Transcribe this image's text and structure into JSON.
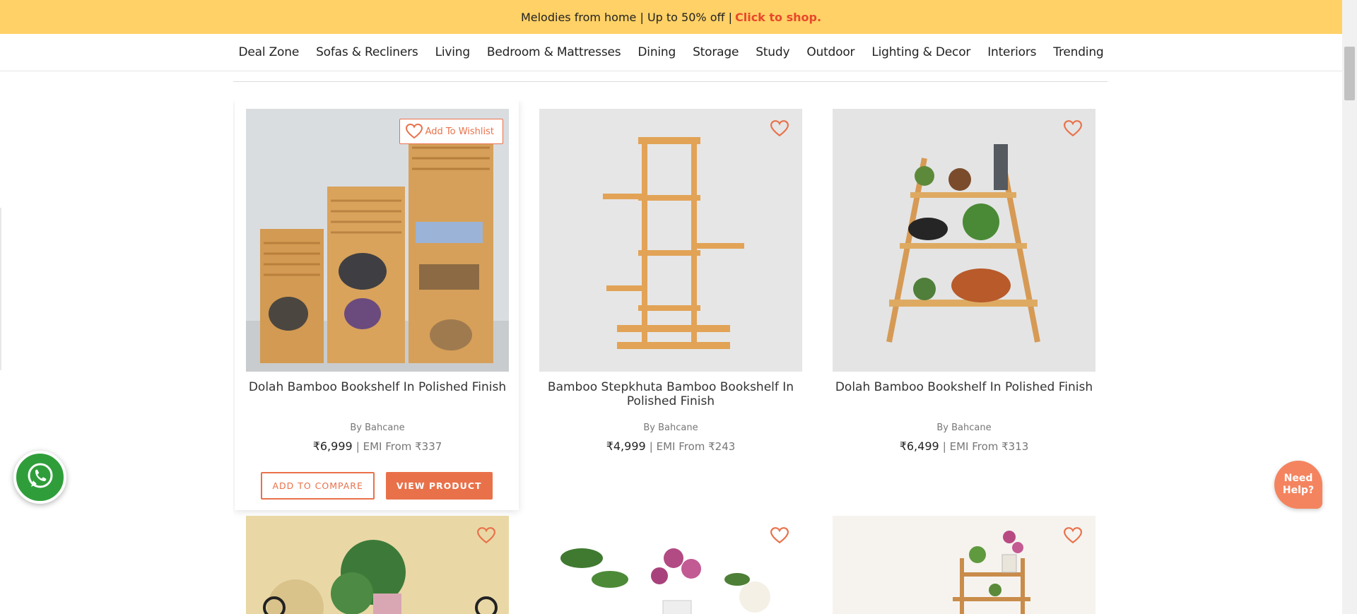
{
  "promo": {
    "text": "Melodies from home | Up to 50% off |",
    "link": "Click to shop."
  },
  "nav": {
    "items": [
      "Deal Zone",
      "Sofas & Recliners",
      "Living",
      "Bedroom & Mattresses",
      "Dining",
      "Storage",
      "Study",
      "Outdoor",
      "Lighting & Decor",
      "Interiors",
      "Trending"
    ]
  },
  "products": [
    {
      "name": "Dolah Bamboo Bookshelf In Polished Finish",
      "brand": "By Bahcane",
      "price": "₹6,999",
      "emi": "| EMI From ₹337",
      "wishlist_label": "Add To Wishlist",
      "compare_label": "ADD TO COMPARE",
      "view_label": "VIEW PRODUCT"
    },
    {
      "name": "Bamboo Stepkhuta Bamboo Bookshelf In Polished Finish",
      "brand": "By Bahcane",
      "price": "₹4,999",
      "emi": "| EMI From ₹243"
    },
    {
      "name": "Dolah Bamboo Bookshelf In Polished Finish",
      "brand": "By Bahcane",
      "price": "₹6,499",
      "emi": "| EMI From ₹313"
    }
  ],
  "help": {
    "label": "Need Help?"
  },
  "colors": {
    "accent": "#e9714a",
    "promo_bg": "#ffd166",
    "whatsapp": "#2f9e3a"
  }
}
